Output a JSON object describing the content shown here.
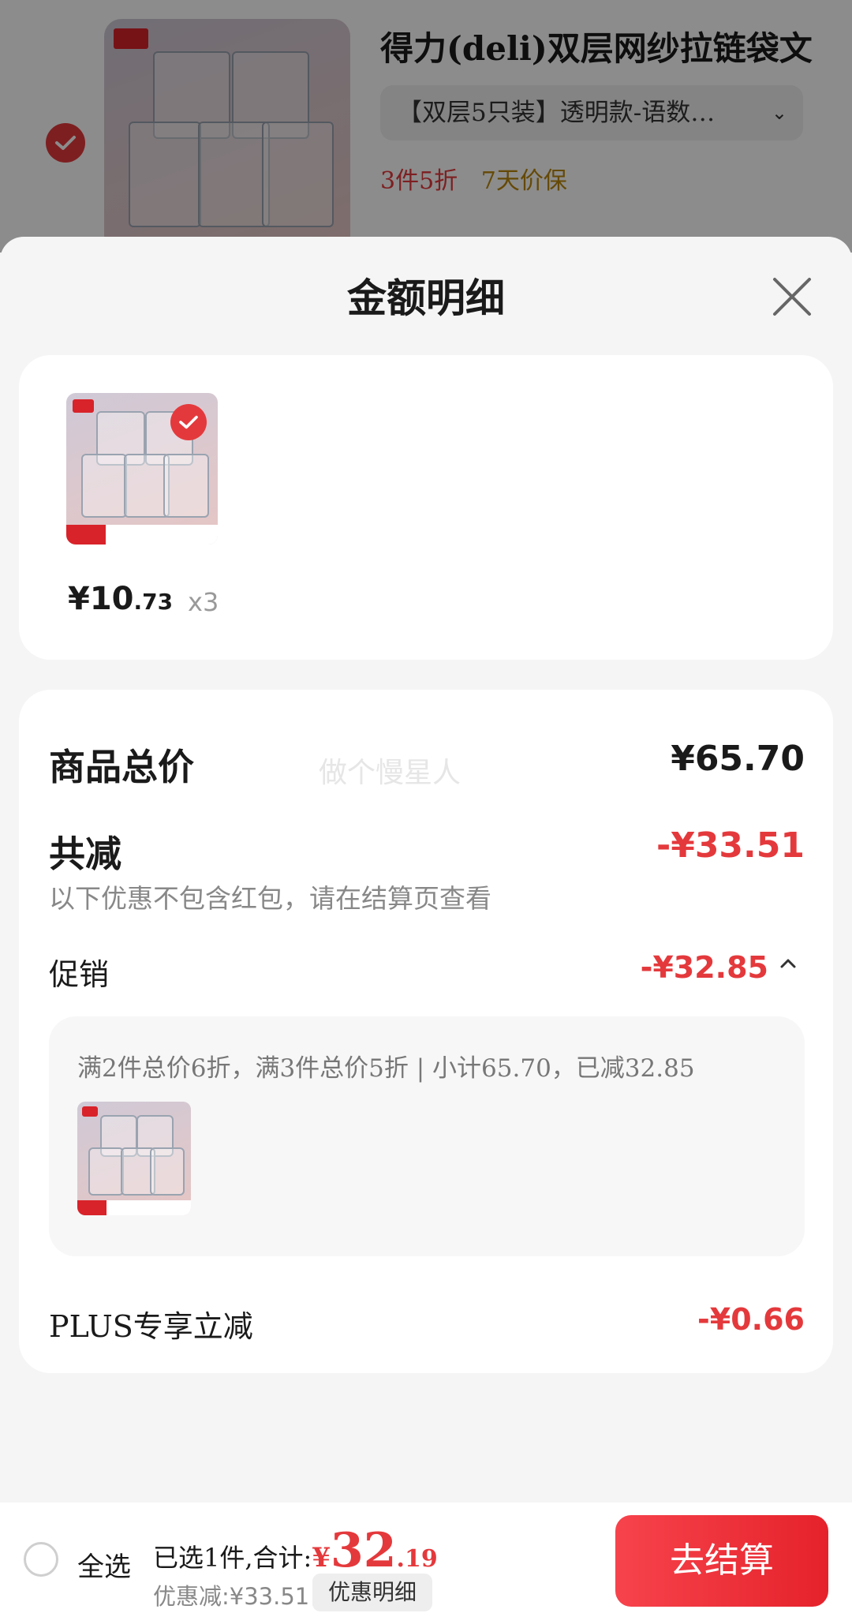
{
  "background_item": {
    "title": "得力(deli)双层网纱拉链袋文",
    "spec": "【双层5只装】透明款-语数…",
    "promo_discount": "3件5折",
    "promo_guarantee": "7天价保"
  },
  "sheet": {
    "title": "金额明细"
  },
  "product": {
    "price_int": "¥10",
    "price_dec": ".73",
    "quantity": "x3"
  },
  "summary": {
    "total_label": "商品总价",
    "total_value": "¥65.70",
    "watermark": "做个慢星人",
    "reduce_label": "共减",
    "reduce_value": "-¥33.51",
    "reduce_note": "以下优惠不包含红包，请在结算页查看",
    "promo_label": "促销",
    "promo_value": "-¥32.85",
    "promo_detail": "满2件总价6折，满3件总价5折 | 小计65.70，已减32.85",
    "plus_label": "PLUS专享立减",
    "plus_value": "-¥0.66"
  },
  "bottom_bar": {
    "select_all": "全选",
    "selected_prefix": "已选1件,合计:",
    "total_currency": "¥",
    "total_int": "32",
    "total_dec": ".19",
    "discount_text": "优惠减:¥33.51",
    "detail_button": "优惠明细",
    "checkout_button": "去结算"
  },
  "colors": {
    "accent": "#e4393c",
    "guarantee": "#b8860b"
  }
}
